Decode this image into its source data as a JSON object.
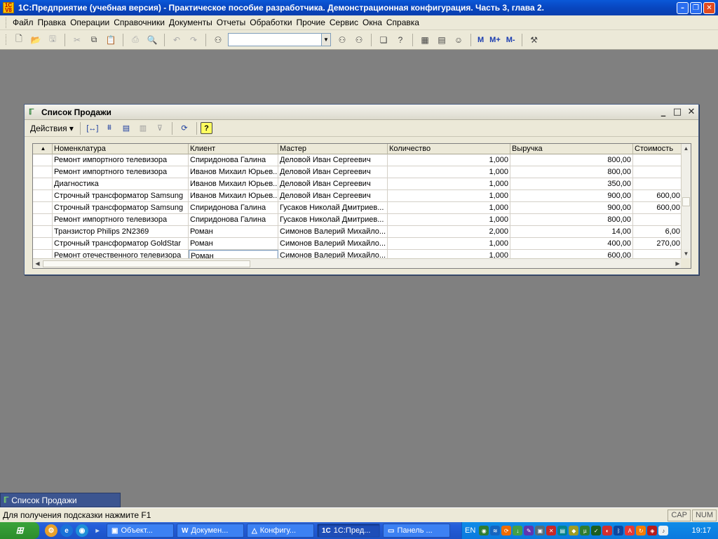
{
  "app": {
    "icon_text": "1С V8",
    "title": "1С:Предприятие (учебная версия) - Практическое пособие разработчика. Демонстрационная конфигурация. Часть 3, глава 2."
  },
  "menu": [
    "Файл",
    "Правка",
    "Операции",
    "Справочники",
    "Документы",
    "Отчеты",
    "Обработки",
    "Прочие",
    "Сервис",
    "Окна",
    "Справка"
  ],
  "toolbar": {
    "search_value": "",
    "m_label": "M",
    "mplus_label": "M+",
    "mminus_label": "M-"
  },
  "window": {
    "title": "Список Продажи",
    "actions_label": "Действия ▾",
    "columns": [
      "Номенклатура",
      "Клиент",
      "Мастер",
      "Количество",
      "Выручка",
      "Стоимость"
    ],
    "rows": [
      [
        "Ремонт импортного телевизора",
        "Спиридонова Галина",
        "Деловой Иван Сергеевич",
        "1,000",
        "800,00",
        ""
      ],
      [
        "Ремонт импортного телевизора",
        "Иванов Михаил Юрьев...",
        "Деловой Иван Сергеевич",
        "1,000",
        "800,00",
        ""
      ],
      [
        "Диагностика",
        "Иванов Михаил Юрьев...",
        "Деловой Иван Сергеевич",
        "1,000",
        "350,00",
        ""
      ],
      [
        "Строчный трансформатор Samsung",
        "Иванов Михаил Юрьев...",
        "Деловой Иван Сергеевич",
        "1,000",
        "900,00",
        "600,00"
      ],
      [
        "Строчный трансформатор Samsung",
        "Спиридонова Галина",
        "Гусаков Николай Дмитриев...",
        "1,000",
        "900,00",
        "600,00"
      ],
      [
        "Ремонт импортного телевизора",
        "Спиридонова Галина",
        "Гусаков Николай Дмитриев...",
        "1,000",
        "800,00",
        ""
      ],
      [
        "Транзистор Philips 2N2369",
        "Роман",
        "Симонов Валерий Михайло...",
        "2,000",
        "14,00",
        "6,00"
      ],
      [
        "Строчный трансформатор GoldStar",
        "Роман",
        "Симонов Валерий Михайло...",
        "1,000",
        "400,00",
        "270,00"
      ],
      [
        "Ремонт отечественного телевизора",
        "Роман",
        "Симонов Валерий Михайло...",
        "1,000",
        "600,00",
        ""
      ]
    ]
  },
  "window_tab": {
    "label": "Список Продажи"
  },
  "status": {
    "hint": "Для получения подсказки нажмите F1",
    "cap": "CAP",
    "num": "NUM"
  },
  "taskbar": {
    "tasks": [
      "Объект...",
      "Докумен...",
      "Конфигу...",
      "1С:Пред...",
      "Панель ..."
    ],
    "lang": "EN",
    "clock": "19:17"
  }
}
